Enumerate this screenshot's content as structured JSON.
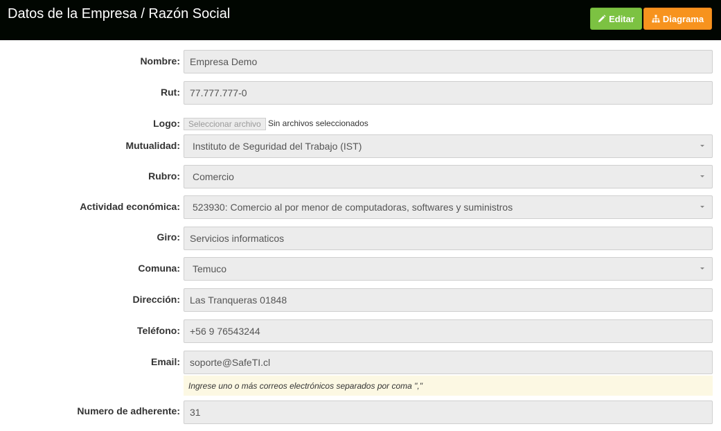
{
  "header": {
    "title": "Datos de la Empresa / Razón Social",
    "edit_label": "Editar",
    "diagram_label": "Diagrama",
    "edit_color": "#7cc242",
    "diagram_color": "#f7931e",
    "edit_icon": "pencil-icon",
    "diagram_icon": "sitemap-icon"
  },
  "form": {
    "nombre": {
      "label": "Nombre:",
      "value": "Empresa Demo"
    },
    "rut": {
      "label": "Rut:",
      "value": "77.777.777-0"
    },
    "logo": {
      "label": "Logo:",
      "button": "Seleccionar archivo",
      "status": "Sin archivos seleccionados"
    },
    "mutualidad": {
      "label": "Mutualidad:",
      "value": "Instituto de Seguridad del Trabajo (IST)"
    },
    "rubro": {
      "label": "Rubro:",
      "value": "Comercio"
    },
    "actividad": {
      "label": "Actividad económica:",
      "value": "523930: Comercio al por menor de computadoras, softwares y suministros"
    },
    "giro": {
      "label": "Giro:",
      "value": "Servicios informaticos"
    },
    "comuna": {
      "label": "Comuna:",
      "value": "Temuco"
    },
    "direccion": {
      "label": "Dirección:",
      "value": "Las Tranqueras 01848"
    },
    "telefono": {
      "label": "Teléfono:",
      "value": "+56 9 76543244"
    },
    "email": {
      "label": "Email:",
      "value": "soporte@SafeTI.cl",
      "help": "Ingrese uno o más correos electrónicos separados por coma \",\""
    },
    "adherente": {
      "label": "Numero de adherente:",
      "value": "31"
    }
  }
}
